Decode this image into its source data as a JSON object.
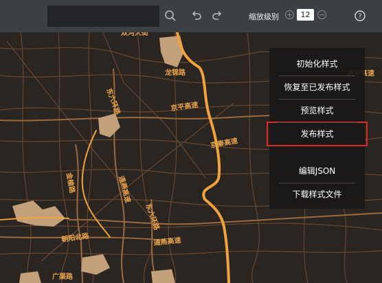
{
  "toolbar": {
    "search_value": "",
    "zoom_label": "缩放级别",
    "zoom_value": "12",
    "icons": [
      "search-icon",
      "undo-icon",
      "redo-icon",
      "zoom-in-icon",
      "zoom-out-icon",
      "help-icon"
    ]
  },
  "menu": {
    "items": [
      {
        "label": "初始化样式"
      },
      {
        "label": "恢复至已发布样式"
      },
      {
        "label": "预览样式"
      },
      {
        "label": "发布样式",
        "highlighted": true
      },
      {
        "label": "编辑JSON"
      },
      {
        "label": "下载样式文件"
      }
    ]
  },
  "map": {
    "labels": [
      "双河大街",
      "龙锦路",
      "京平高速",
      "东六环路",
      "京平高速",
      "京秦高速",
      "金榆路",
      "通燕高速",
      "东六环路",
      "朝阳北路",
      "通燕高速",
      "广渠路"
    ]
  },
  "colors": {
    "map_background": "#2b2522",
    "highway": "#f0a33c",
    "road": "#7a5236",
    "area": "#c2a07a",
    "toolbar": "#3c3f44",
    "highlight": "#e02a2a"
  }
}
